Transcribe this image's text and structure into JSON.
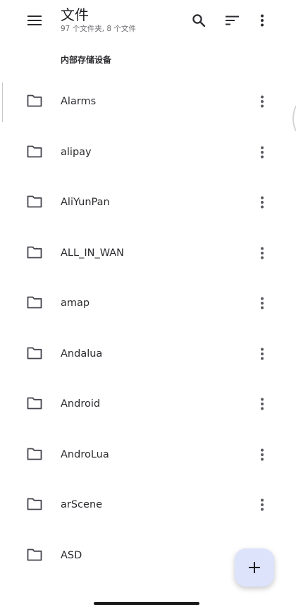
{
  "appbar": {
    "title": "文件",
    "subtitle": "97 个文件夹, 8 个文件",
    "icons": {
      "menu": "menu-icon",
      "search": "search-icon",
      "sort": "sort-icon",
      "more": "more-vert-icon"
    }
  },
  "section": {
    "header": "内部存储设备"
  },
  "folders": [
    {
      "name": "Alarms"
    },
    {
      "name": "alipay"
    },
    {
      "name": "AliYunPan"
    },
    {
      "name": "ALL_IN_WAN"
    },
    {
      "name": "amap"
    },
    {
      "name": "Andalua"
    },
    {
      "name": "Android"
    },
    {
      "name": "AndroLua"
    },
    {
      "name": "arScene"
    },
    {
      "name": "ASD"
    }
  ],
  "fab": {
    "icon": "add-icon"
  },
  "colors": {
    "background": "#ffffff",
    "icon": "#45464f",
    "fab_bg": "#dce3fb",
    "text_primary": "#1b1b1f",
    "text_secondary": "#6b6b6f"
  }
}
